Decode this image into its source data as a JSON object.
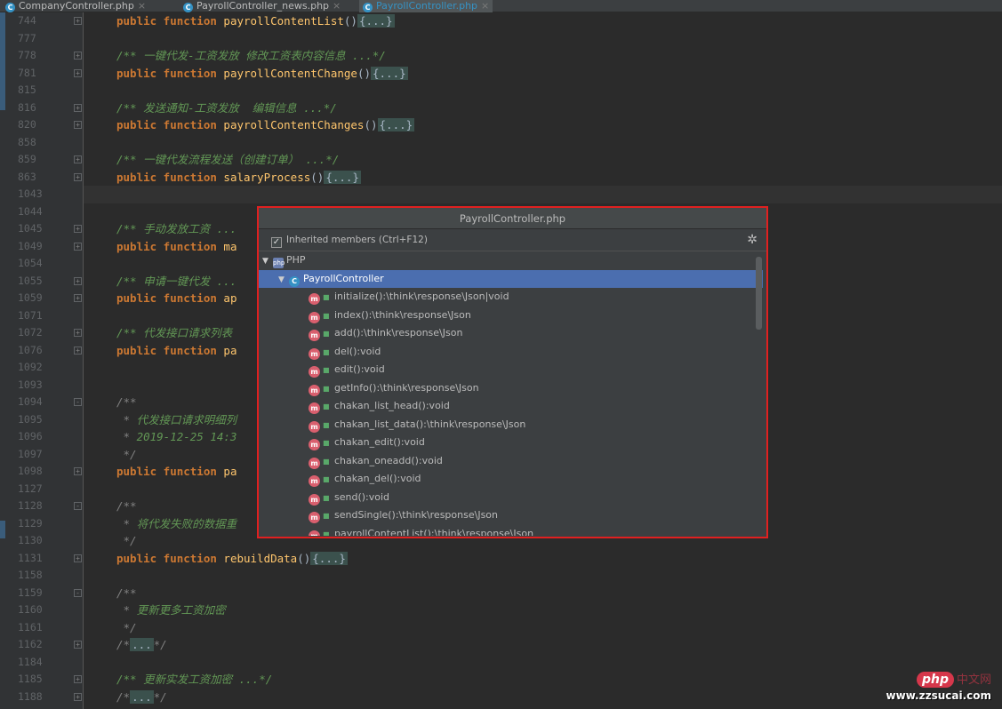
{
  "tabs": [
    {
      "label": "CompanyController.php",
      "close": "×"
    },
    {
      "label": "PayrollController_news.php",
      "close": "×"
    },
    {
      "label": "PayrollController.php",
      "close": "×"
    }
  ],
  "editor_lines": [
    {
      "ln": "744",
      "fold": "+",
      "parts": [
        [
          "kw",
          "public function "
        ],
        [
          "fn",
          "payrollContentList"
        ],
        [
          "p",
          "()"
        ],
        [
          "fd",
          "{...}"
        ]
      ]
    },
    {
      "ln": "777",
      "fold": "",
      "parts": []
    },
    {
      "ln": "778",
      "fold": "+",
      "parts": [
        [
          "cm",
          "/** 一键代发-工资发放 修改工资表内容信息 ...*/"
        ]
      ]
    },
    {
      "ln": "781",
      "fold": "+",
      "parts": [
        [
          "kw",
          "public function "
        ],
        [
          "fn",
          "payrollContentChange"
        ],
        [
          "p",
          "()"
        ],
        [
          "fd",
          "{...}"
        ]
      ]
    },
    {
      "ln": "815",
      "fold": "",
      "parts": []
    },
    {
      "ln": "816",
      "fold": "+",
      "parts": [
        [
          "cm",
          "/** 发送通知-工资发放  编辑信息 ...*/"
        ]
      ]
    },
    {
      "ln": "820",
      "fold": "+",
      "parts": [
        [
          "kw",
          "public function "
        ],
        [
          "fn",
          "payrollContentChanges"
        ],
        [
          "p",
          "()"
        ],
        [
          "fd",
          "{...}"
        ]
      ]
    },
    {
      "ln": "858",
      "fold": "",
      "parts": []
    },
    {
      "ln": "859",
      "fold": "+",
      "parts": [
        [
          "cm",
          "/** 一键代发流程发送（创建订单） ...*/"
        ]
      ]
    },
    {
      "ln": "863",
      "fold": "+",
      "parts": [
        [
          "kw",
          "public function "
        ],
        [
          "fn",
          "salaryProcess"
        ],
        [
          "p",
          "()"
        ],
        [
          "fd",
          "{...}"
        ]
      ]
    },
    {
      "ln": "1043",
      "fold": "",
      "parts": []
    },
    {
      "ln": "1044",
      "fold": "",
      "parts": []
    },
    {
      "ln": "1045",
      "fold": "+",
      "parts": [
        [
          "cm",
          "/** 手动发放工资 ..."
        ]
      ]
    },
    {
      "ln": "1049",
      "fold": "+",
      "parts": [
        [
          "kw",
          "public function "
        ],
        [
          "fn",
          "ma"
        ]
      ]
    },
    {
      "ln": "1054",
      "fold": "",
      "parts": []
    },
    {
      "ln": "1055",
      "fold": "+",
      "parts": [
        [
          "cm",
          "/** 申请一键代发 ..."
        ]
      ]
    },
    {
      "ln": "1059",
      "fold": "+",
      "parts": [
        [
          "kw",
          "public function "
        ],
        [
          "fn",
          "ap"
        ]
      ]
    },
    {
      "ln": "1071",
      "fold": "",
      "parts": []
    },
    {
      "ln": "1072",
      "fold": "+",
      "parts": [
        [
          "cm",
          "/** 代发接口请求列表"
        ]
      ]
    },
    {
      "ln": "1076",
      "fold": "+",
      "parts": [
        [
          "kw",
          "public function "
        ],
        [
          "fn",
          "pa"
        ]
      ]
    },
    {
      "ln": "1092",
      "fold": "",
      "parts": []
    },
    {
      "ln": "1093",
      "fold": "",
      "parts": []
    },
    {
      "ln": "1094",
      "fold": "-",
      "parts": [
        [
          "cmt",
          "/**"
        ]
      ]
    },
    {
      "ln": "1095",
      "fold": "",
      "parts": [
        [
          "cmt",
          " * "
        ],
        [
          "cm",
          "代发接口请求明细列"
        ]
      ]
    },
    {
      "ln": "1096",
      "fold": "",
      "parts": [
        [
          "cmt",
          " * "
        ],
        [
          "cm",
          "2019-12-25 14:3"
        ]
      ]
    },
    {
      "ln": "1097",
      "fold": "",
      "parts": [
        [
          "cmt",
          " */"
        ]
      ]
    },
    {
      "ln": "1098",
      "fold": "+",
      "parts": [
        [
          "kw",
          "public function "
        ],
        [
          "fn",
          "pa"
        ]
      ]
    },
    {
      "ln": "1127",
      "fold": "",
      "parts": []
    },
    {
      "ln": "1128",
      "fold": "-",
      "parts": [
        [
          "cmt",
          "/**"
        ]
      ]
    },
    {
      "ln": "1129",
      "fold": "",
      "parts": [
        [
          "cmt",
          " * "
        ],
        [
          "cm",
          "将代发失败的数据重"
        ]
      ]
    },
    {
      "ln": "1130",
      "fold": "",
      "parts": [
        [
          "cmt",
          " */"
        ]
      ]
    },
    {
      "ln": "1131",
      "fold": "+",
      "parts": [
        [
          "kw",
          "public function "
        ],
        [
          "fn",
          "rebuildData"
        ],
        [
          "p",
          "()"
        ],
        [
          "fd",
          "{...}"
        ]
      ]
    },
    {
      "ln": "1158",
      "fold": "",
      "parts": []
    },
    {
      "ln": "1159",
      "fold": "-",
      "parts": [
        [
          "cmt",
          "/**"
        ]
      ]
    },
    {
      "ln": "1160",
      "fold": "",
      "parts": [
        [
          "cmt",
          " * "
        ],
        [
          "cm",
          "更新更多工资加密"
        ]
      ]
    },
    {
      "ln": "1161",
      "fold": "",
      "parts": [
        [
          "cmt",
          " */"
        ]
      ]
    },
    {
      "ln": "1162",
      "fold": "+",
      "parts": [
        [
          "cmt",
          "/*"
        ],
        [
          "fd",
          "..."
        ],
        [
          "cmt",
          "*/"
        ]
      ]
    },
    {
      "ln": "1184",
      "fold": "",
      "parts": []
    },
    {
      "ln": "1185",
      "fold": "+",
      "parts": [
        [
          "cm",
          "/** 更新实发工资加密 ...*/"
        ]
      ]
    },
    {
      "ln": "1188",
      "fold": "+",
      "parts": [
        [
          "cmt",
          "/*"
        ],
        [
          "fd",
          "..."
        ],
        [
          "cmt",
          "*/"
        ]
      ]
    }
  ],
  "popup": {
    "title": "PayrollController.php",
    "option_label": "Inherited members (Ctrl+F12)",
    "option_checked": true,
    "root": "PHP",
    "class_name": "PayrollController",
    "members": [
      "initialize():\\think\\response\\Json|void",
      "index():\\think\\response\\Json",
      "add():\\think\\response\\Json",
      "del():void",
      "edit():void",
      "getInfo():\\think\\response\\Json",
      "chakan_list_head():void",
      "chakan_list_data():\\think\\response\\Json",
      "chakan_edit():void",
      "chakan_oneadd():void",
      "chakan_del():void",
      "send():void",
      "sendSingle():\\think\\response\\Json",
      "payrollContentList():\\think\\response\\Json"
    ]
  },
  "watermark": {
    "logo": "php",
    "cn": "中文网",
    "url": "www.zzsucai.com"
  },
  "colors": {
    "accent": "#3592c4",
    "selection": "#4b6eaf",
    "highlight_border": "#e02020"
  }
}
